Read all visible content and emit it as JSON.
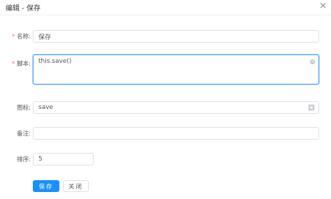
{
  "dialog": {
    "title": "编辑 - 保存",
    "close_symbol": "×"
  },
  "form": {
    "name": {
      "label": "名称:",
      "required": "*",
      "value": "保存"
    },
    "script": {
      "label": "脚本:",
      "required": "*",
      "value": "this.save()"
    },
    "icon": {
      "label": "图标:",
      "value": "save"
    },
    "remark": {
      "label": "备注:",
      "value": ""
    },
    "sort": {
      "label": "排序:",
      "value": "5"
    }
  },
  "buttons": {
    "save_label": "保存",
    "close_label": "关闭"
  },
  "colors": {
    "primary": "#1890ff",
    "required": "#f56c6c",
    "focus_border": "#409eff"
  },
  "icons": {
    "close": "close-icon",
    "clear": "circle-close-icon",
    "icon_picker": "image-picker-icon"
  }
}
